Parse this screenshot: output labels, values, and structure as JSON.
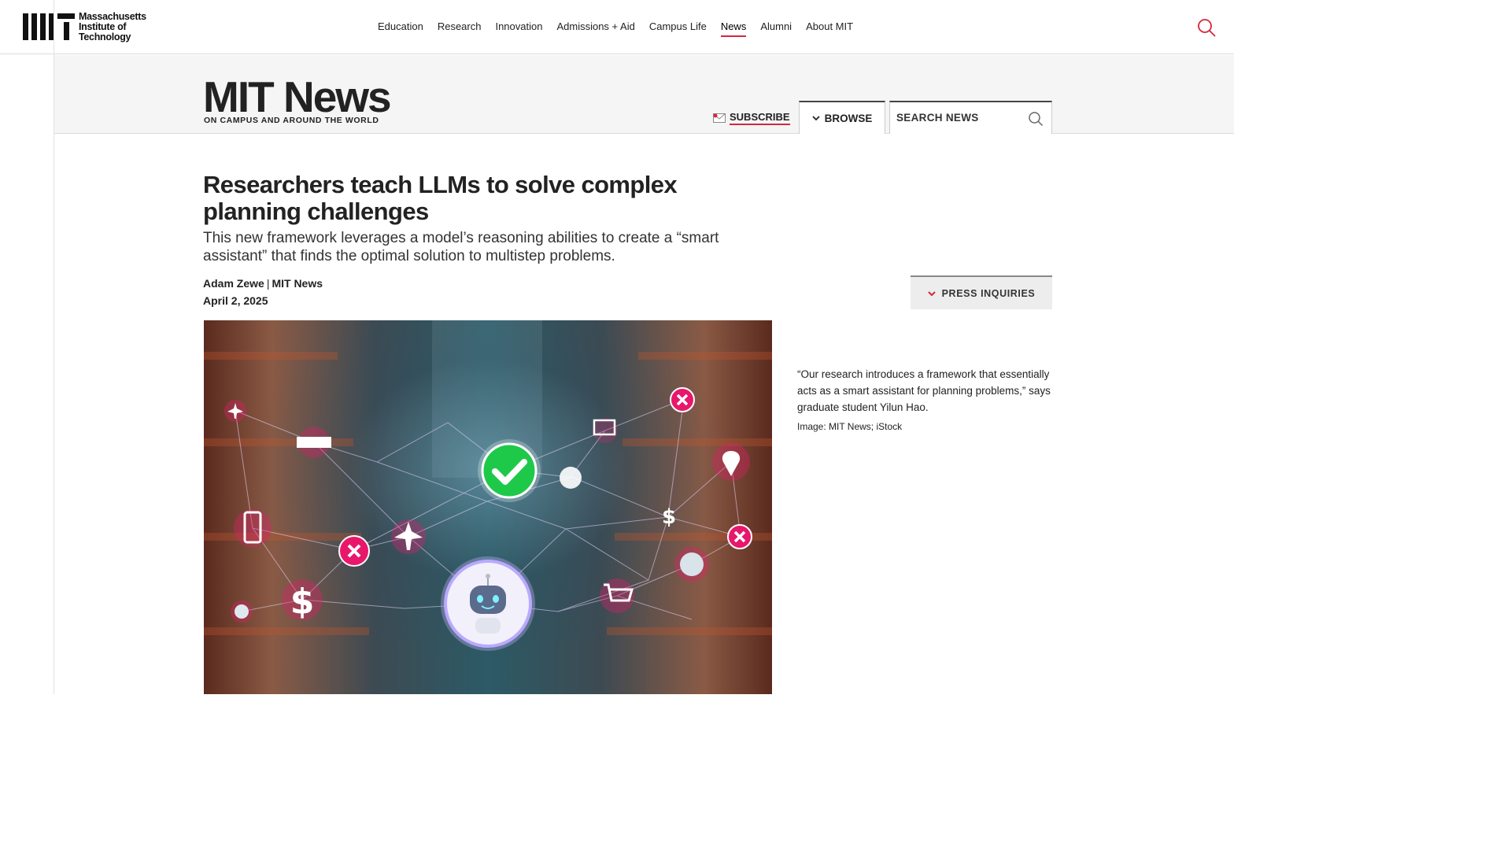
{
  "site": {
    "wordmark": [
      "Massachusetts",
      "Institute of",
      "Technology"
    ]
  },
  "nav": {
    "items": [
      "Education",
      "Research",
      "Innovation",
      "Admissions + Aid",
      "Campus Life",
      "News",
      "Alumni",
      "About MIT"
    ],
    "active": "News"
  },
  "news_header": {
    "title": "MIT News",
    "tagline": "ON CAMPUS AND AROUND THE WORLD",
    "subscribe": "SUBSCRIBE",
    "browse": "BROWSE",
    "search_placeholder": "SEARCH NEWS"
  },
  "article": {
    "headline": "Researchers teach LLMs to solve complex planning challenges",
    "dek": "This new framework leverages a model’s reasoning abilities to create a “smart assistant” that finds the optimal solution to multistep problems.",
    "author": "Adam Zewe",
    "publication": "MIT News",
    "date": "April 2, 2025",
    "caption": "“Our research introduces a framework that essentially acts as a smart assistant for planning problems,” says graduate student Yilun Hao.",
    "credit": "Image: MIT News; iStock"
  },
  "sidebar": {
    "press_inquiries": "PRESS INQUIRIES"
  },
  "colors": {
    "accent": "#d7263d",
    "check_green": "#1ec94a",
    "error_pink": "#e8176b"
  }
}
